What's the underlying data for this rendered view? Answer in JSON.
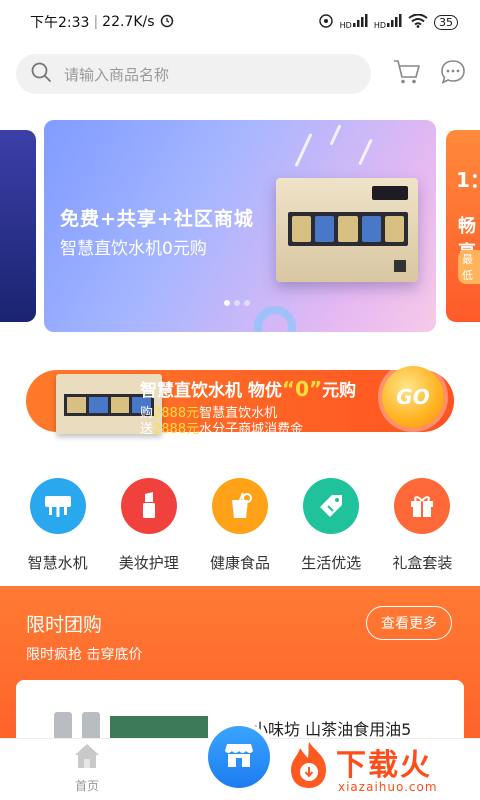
{
  "status_bar": {
    "time": "下午2:33",
    "speed": "22.7K/s",
    "hd1": "HD",
    "hd2": "HD",
    "battery": "35"
  },
  "search": {
    "placeholder": "请输入商品名称"
  },
  "banner": {
    "line1": "免费+共享+社区商城",
    "line2": "智慧直饮水机0元购",
    "side_right_top": "1：",
    "side_right_mid": "畅享",
    "side_right_tag": "最低"
  },
  "promo": {
    "title_prefix": "智慧直饮水机  物优",
    "title_zero": "“0”",
    "title_suffix": "元购",
    "line1_pre": "购",
    "line1_hl": "2888元",
    "line1_post": "智慧直饮水机",
    "line2_pre": "送",
    "line2_hl": "2888元",
    "line2_post": "水分子商城消费金",
    "go": "GO"
  },
  "categories": [
    {
      "label": "智慧水机",
      "color": "#29a8ee",
      "icon": "water-purifier-icon"
    },
    {
      "label": "美妆护理",
      "color": "#f0413d",
      "icon": "lipstick-icon"
    },
    {
      "label": "健康食品",
      "color": "#ffa217",
      "icon": "drink-icon"
    },
    {
      "label": "生活优选",
      "color": "#1fc29a",
      "icon": "tag-icon"
    },
    {
      "label": "礼盒套装",
      "color": "#ff6838",
      "icon": "gift-icon"
    }
  ],
  "flash_sale": {
    "title": "限时团购",
    "subtitle": "限时疯抢 击穿底价",
    "more": "查看更多",
    "product_name": "小味坊 山茶油食用油5"
  },
  "tabbar": {
    "home": "首页"
  },
  "watermark": {
    "big": "下载火",
    "small": "xiazaihuo.com"
  }
}
